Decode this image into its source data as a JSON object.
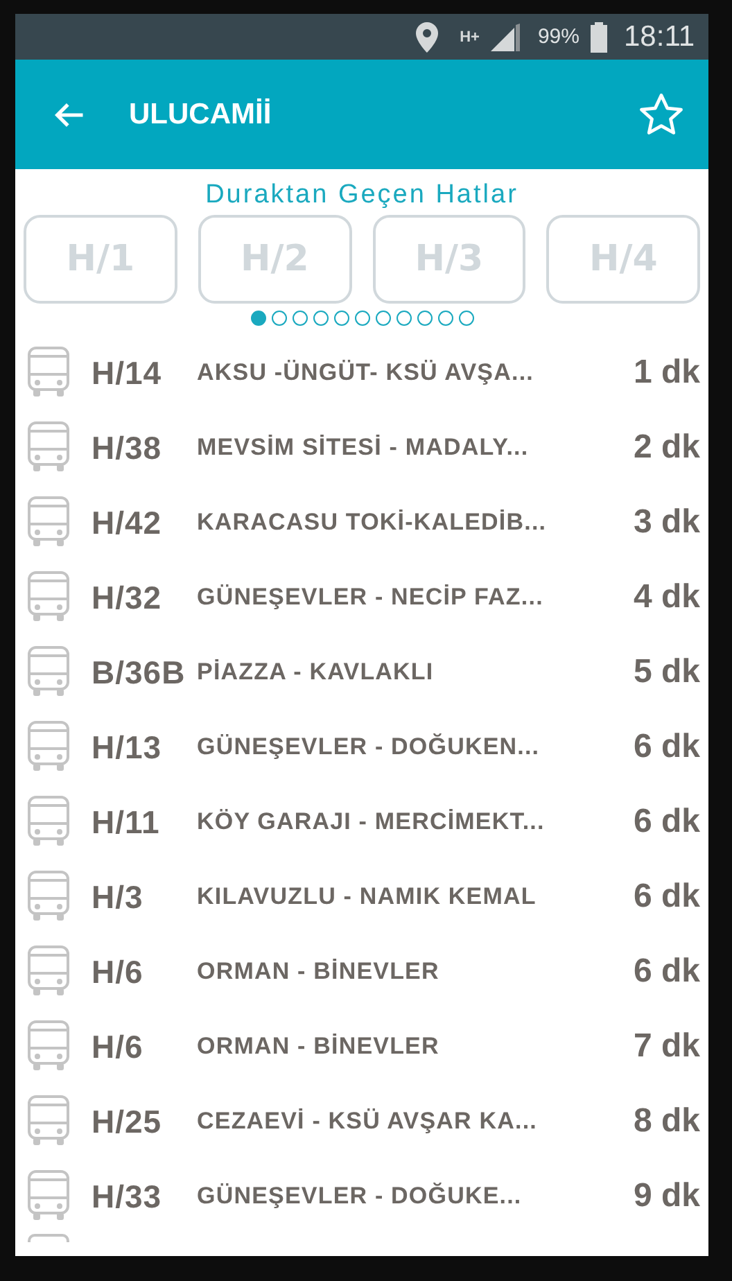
{
  "status_bar": {
    "network": "H+",
    "battery": "99%",
    "time": "18:11"
  },
  "app_bar": {
    "title": "ULUCAMİİ"
  },
  "section_title": "Duraktan Geçen Hatlar",
  "line_chips": [
    {
      "label": "H/1"
    },
    {
      "label": "H/2"
    },
    {
      "label": "H/3"
    },
    {
      "label": "H/4"
    }
  ],
  "page_dots": [
    {
      "selected": true
    },
    {
      "selected": false
    },
    {
      "selected": false
    },
    {
      "selected": false
    },
    {
      "selected": false
    },
    {
      "selected": false
    },
    {
      "selected": false
    },
    {
      "selected": false
    },
    {
      "selected": false
    },
    {
      "selected": false
    },
    {
      "selected": false
    }
  ],
  "arrivals": [
    {
      "line": "H/14",
      "route": "AKSU -ÜNGÜT- KSÜ AVŞA...",
      "time": "1 dk"
    },
    {
      "line": "H/38",
      "route": "MEVSİM SİTESİ - MADALY...",
      "time": "2 dk"
    },
    {
      "line": "H/42",
      "route": "KARACASU TOKİ-KALEDİB...",
      "time": "3 dk"
    },
    {
      "line": "H/32",
      "route": "GÜNEŞEVLER - NECİP FAZ...",
      "time": "4 dk"
    },
    {
      "line": "B/36B",
      "route": "PİAZZA - KAVLAKLI",
      "time": "5 dk"
    },
    {
      "line": "H/13",
      "route": "GÜNEŞEVLER - DOĞUKEN...",
      "time": "6 dk"
    },
    {
      "line": "H/11",
      "route": "KÖY GARAJI - MERCİMEKT...",
      "time": "6 dk"
    },
    {
      "line": "H/3",
      "route": "KILAVUZLU - NAMIK KEMAL",
      "time": "6 dk"
    },
    {
      "line": "H/6",
      "route": "ORMAN - BİNEVLER",
      "time": "6 dk"
    },
    {
      "line": "H/6",
      "route": "ORMAN - BİNEVLER",
      "time": "7 dk"
    },
    {
      "line": "H/25",
      "route": "CEZAEVİ - KSÜ AVŞAR KA...",
      "time": "8 dk"
    },
    {
      "line": "H/33",
      "route": "GÜNEŞEVLER - DOĞUKE...",
      "time": "9 dk"
    }
  ]
}
